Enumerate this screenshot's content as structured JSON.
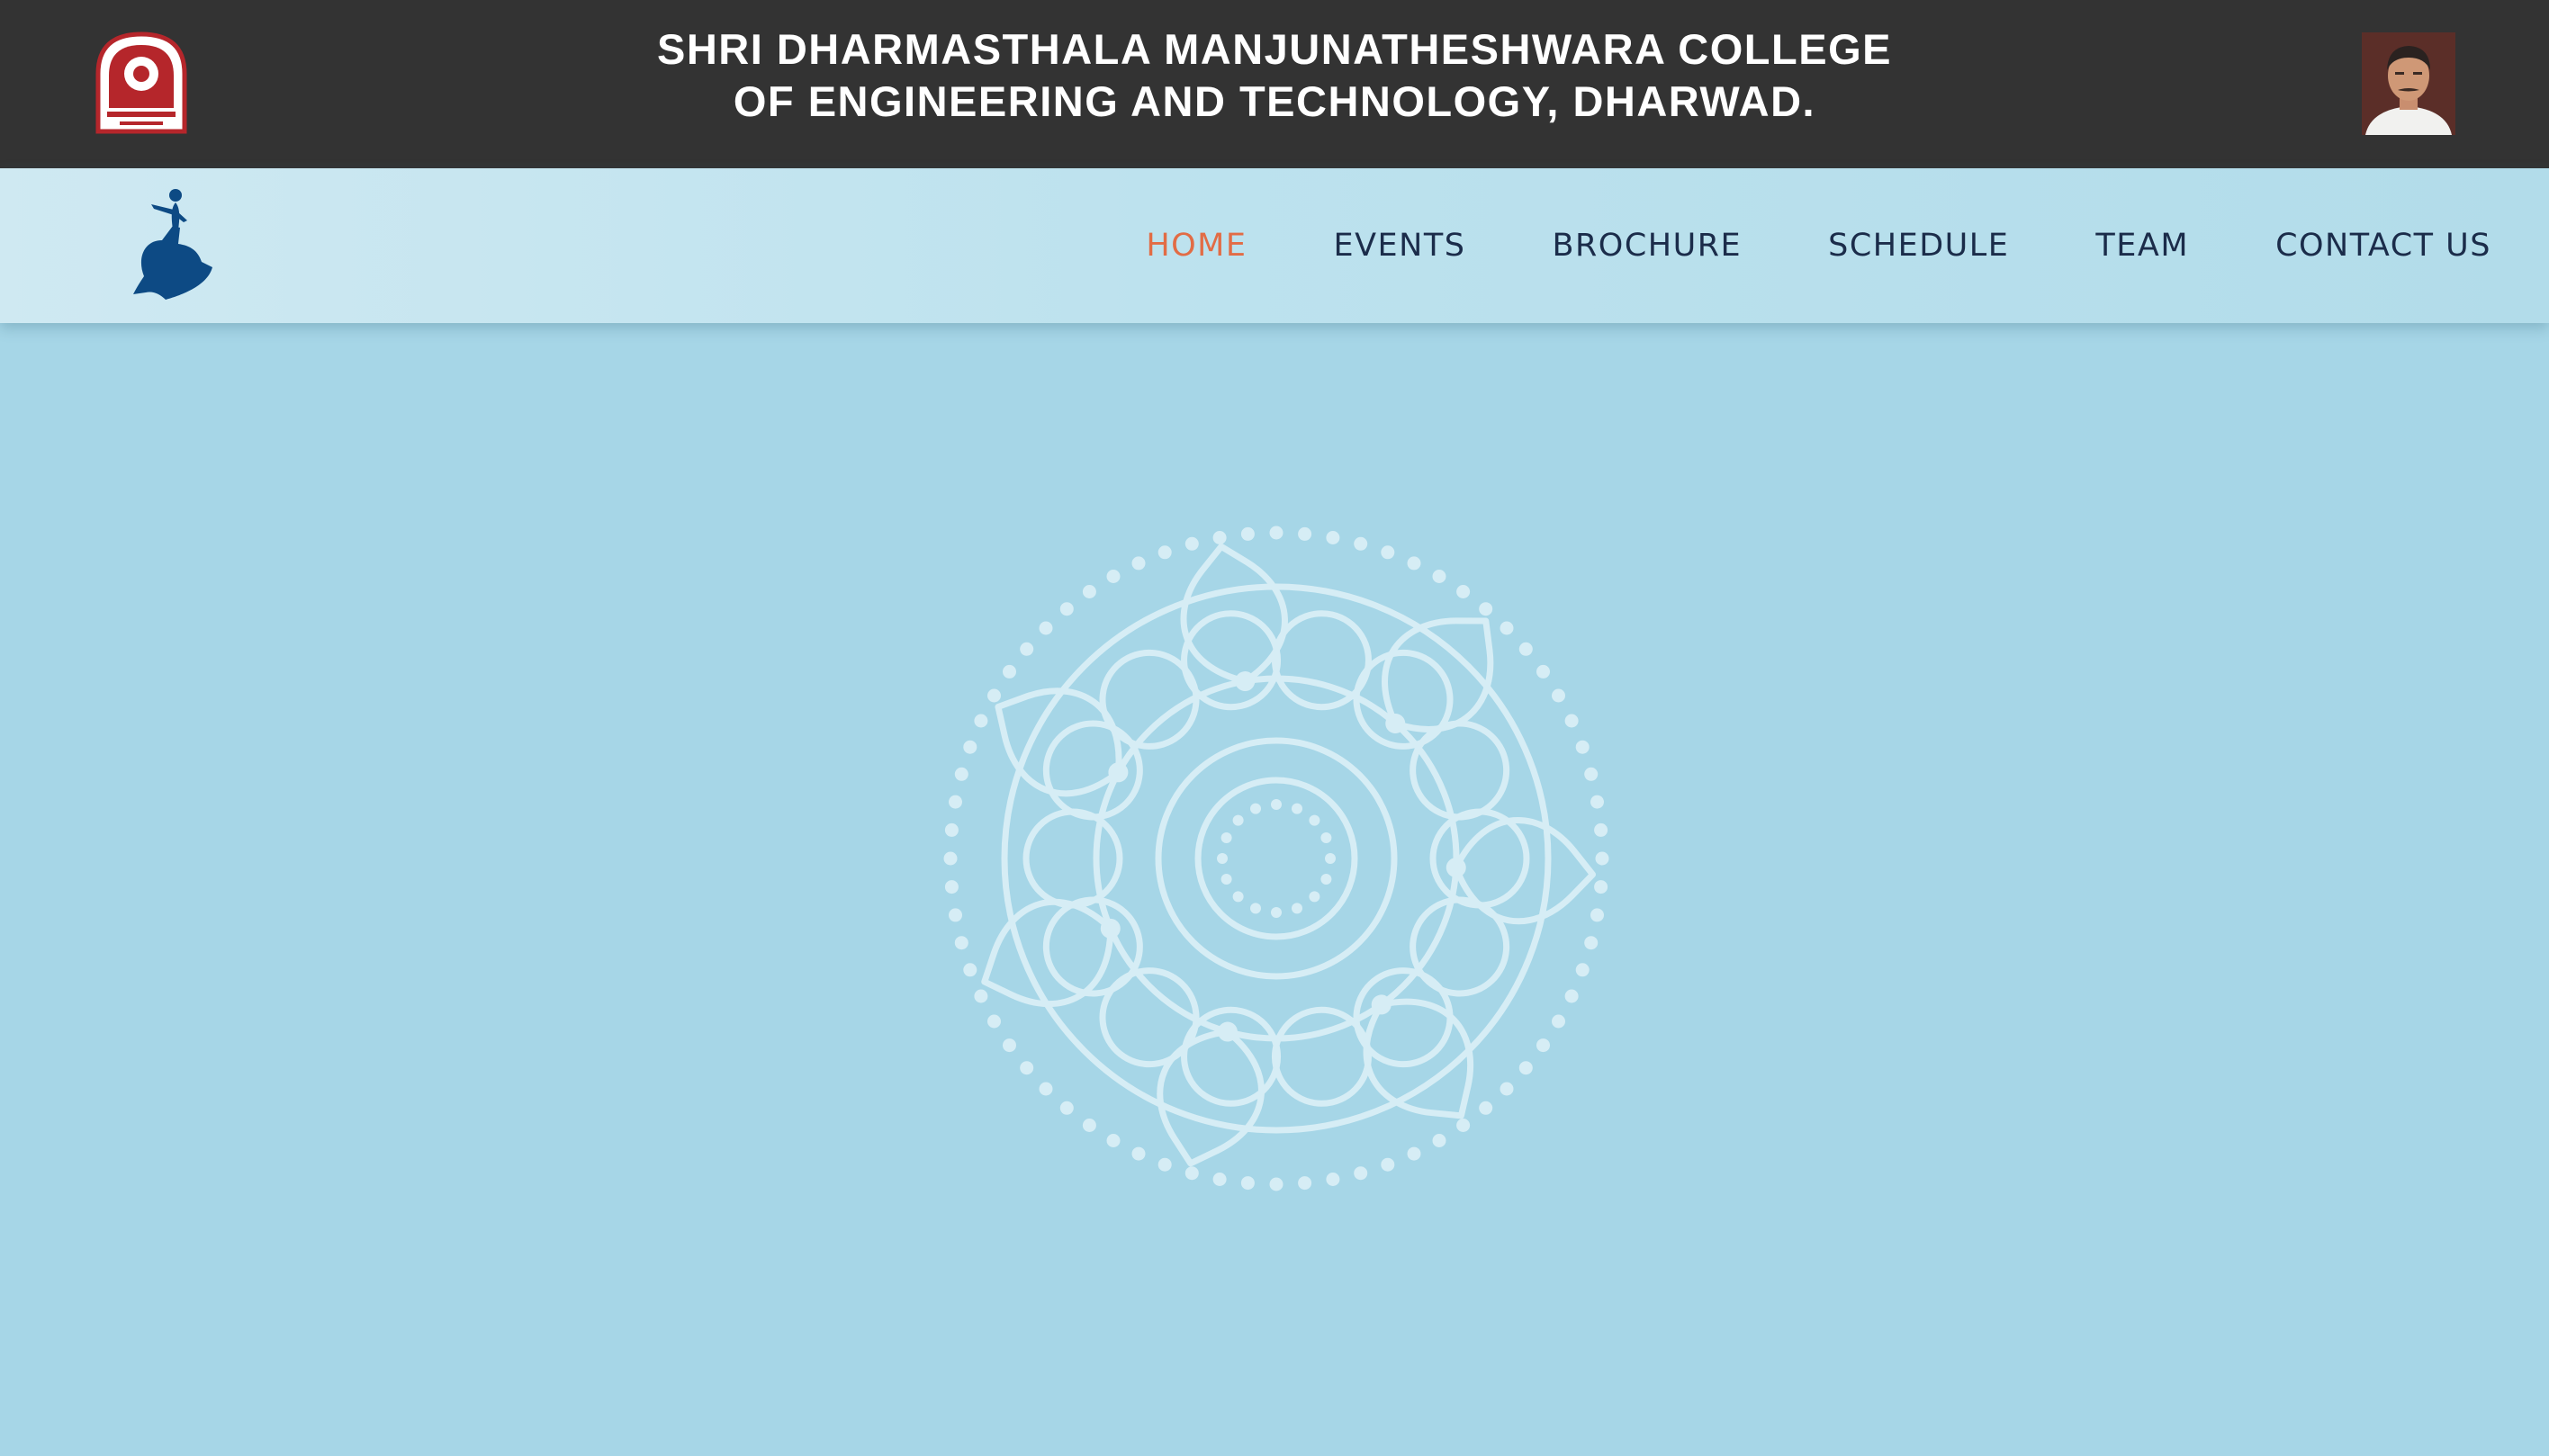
{
  "header": {
    "title_line1": "SHRI DHARMASTHALA MANJUNATHESHWARA COLLEGE",
    "title_line2": "OF ENGINEERING AND TECHNOLOGY, DHARWAD.",
    "logo_icon": "college-crest-icon",
    "portrait": "person-portrait"
  },
  "navbar": {
    "logo_icon": "dancer-logo-icon",
    "items": [
      {
        "label": "HOME",
        "active": true
      },
      {
        "label": "EVENTS",
        "active": false
      },
      {
        "label": "BROCHURE",
        "active": false
      },
      {
        "label": "SCHEDULE",
        "active": false
      },
      {
        "label": "TEAM",
        "active": false
      },
      {
        "label": "CONTACT US",
        "active": false
      }
    ]
  },
  "hero": {
    "decoration_icon": "mandala-icon"
  },
  "colors": {
    "topbar_bg": "#333333",
    "page_bg": "#a6d6e7",
    "nav_text": "#1b2c4a",
    "nav_active": "#e26c45",
    "logo_blue": "#0d4a84",
    "crest_red": "#b5262b"
  }
}
